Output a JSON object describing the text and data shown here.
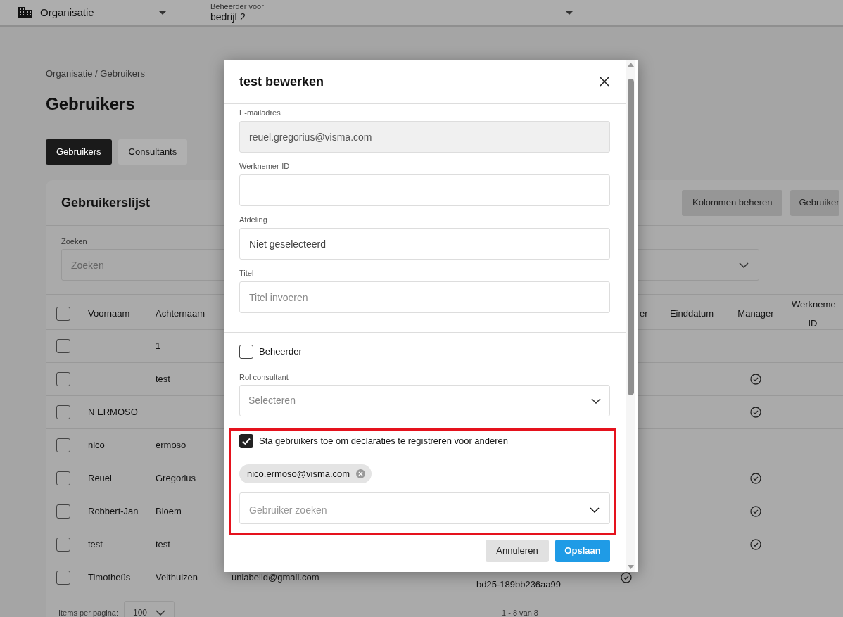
{
  "top_bar": {
    "organisation_select": "Organisatie",
    "admin_for_label": "Beheerder voor",
    "admin_for_value": "bedrijf 2"
  },
  "breadcrumb": "Organisatie / Gebruikers",
  "heading": "Gebruikers",
  "tabs": [
    {
      "label": "Gebruikers",
      "selected": true
    },
    {
      "label": "Consultants",
      "selected": false
    }
  ],
  "card": {
    "title": "Gebruikerslijst",
    "buttons": [
      "Kolommen beheren",
      "Gebruiker"
    ],
    "search": {
      "label": "Zoeken",
      "placeholder": "Zoeken"
    },
    "table": {
      "header_checked": false,
      "columns": [
        "Voornaam",
        "Achternaam",
        "er",
        "Einddatum",
        "Manager",
        "Werkneme ID"
      ],
      "rows": [
        {
          "checked": false,
          "first_name": "",
          "last_name": "1",
          "partial": false,
          "manager": false
        },
        {
          "checked": false,
          "first_name": "",
          "last_name": "test",
          "partial": false,
          "manager": true
        },
        {
          "checked": false,
          "first_name": "N ERMOSO",
          "last_name": "",
          "partial": false,
          "manager": true
        },
        {
          "checked": false,
          "first_name": "nico",
          "last_name": "ermoso",
          "partial": false,
          "manager": false
        },
        {
          "checked": false,
          "first_name": "Reuel",
          "last_name": "Gregorius",
          "partial": false,
          "manager": true
        },
        {
          "checked": false,
          "first_name": "Robbert-Jan",
          "last_name": "Bloem",
          "partial": false,
          "manager": true
        },
        {
          "checked": false,
          "first_name": "test",
          "last_name": "test",
          "partial": false,
          "manager": true
        },
        {
          "checked": false,
          "first_name": "Timotheüs",
          "last_name": "Velthuizen",
          "email": "unlabelld@gmail.com",
          "id": "bd25-189bb236aa99",
          "partial": true,
          "manager": false
        }
      ]
    },
    "pagination": {
      "label": "Items per pagina:",
      "value": "100",
      "range": "1 - 8 van 8"
    }
  },
  "modal": {
    "title": "test bewerken",
    "fields": [
      {
        "label": "E-mailadres",
        "value": "reuel.gregorius@visma.com",
        "disabled": true
      },
      {
        "label": "Werknemer-ID",
        "disabled": false
      },
      {
        "label": "Afdeling",
        "value": "Niet geselecteerd",
        "disabled": false
      },
      {
        "label": "Titel",
        "placeholder": "Titel invoeren",
        "disabled": false
      }
    ],
    "admin_checkbox": {
      "label": "Beheerder",
      "checked": false
    },
    "role": {
      "label": "Rol consultant",
      "placeholder": "Selecteren"
    },
    "delegate_checkbox": {
      "label": "Sta gebruikers toe om declaraties te registreren voor anderen",
      "checked": true
    },
    "chips": [
      "nico.ermoso@visma.com"
    ],
    "user_search": {
      "placeholder": "Gebruiker zoeken"
    },
    "highlighted": true,
    "buttons": [
      {
        "label": "Annuleren",
        "kind": "secondary"
      },
      {
        "label": "Opslaan",
        "kind": "primary"
      }
    ]
  }
}
